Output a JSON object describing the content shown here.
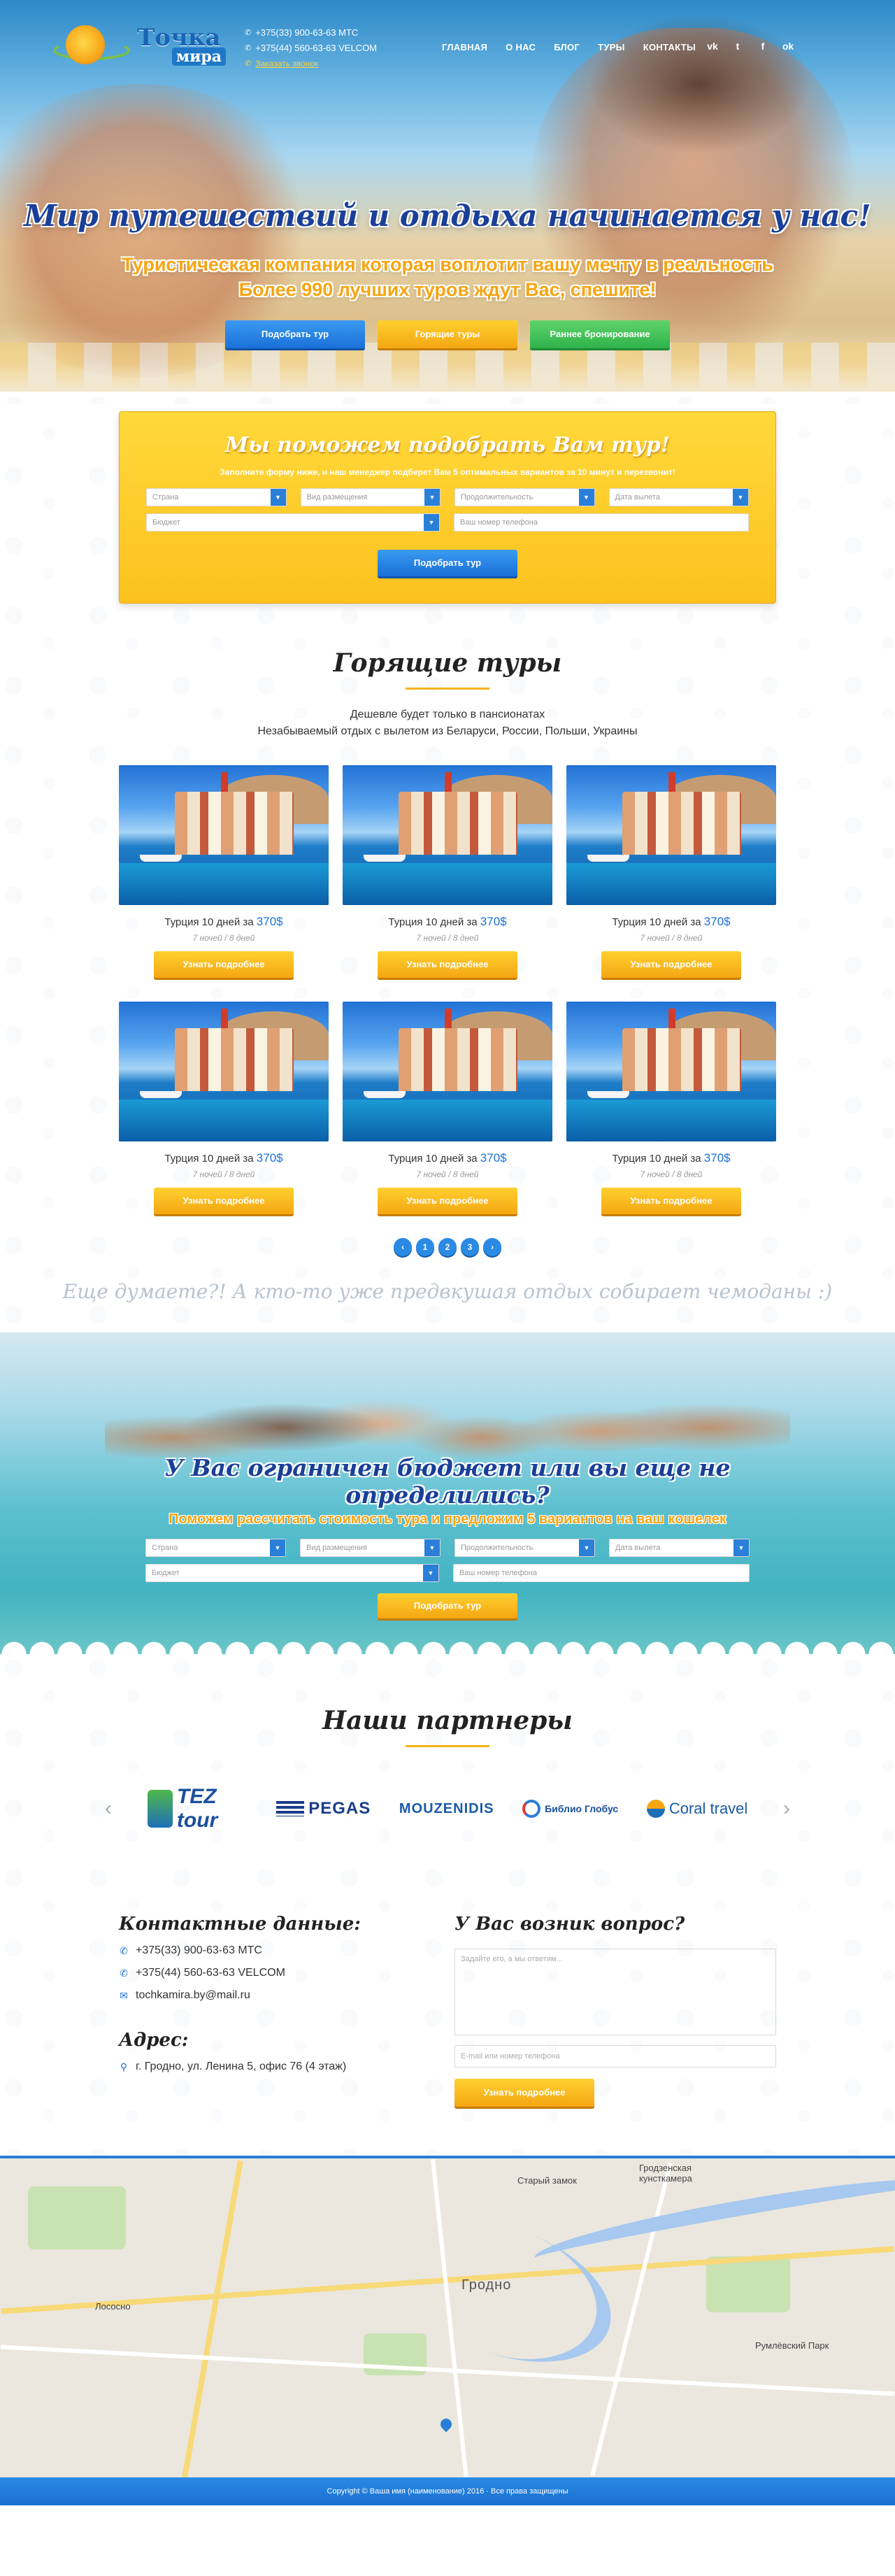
{
  "header": {
    "logo": {
      "line1": "Точка",
      "line2": "мира"
    },
    "phones": [
      {
        "icon": "phone-icon",
        "text": "+375(33) 900-63-63 МТС"
      },
      {
        "icon": "phone-icon",
        "text": "+375(44) 560-63-63 VELCOM"
      }
    ],
    "callback_label": "Заказать звонок",
    "nav": [
      "ГЛАВНАЯ",
      "О НАС",
      "БЛОГ",
      "ТУРЫ",
      "КОНТАКТЫ"
    ],
    "social": [
      {
        "icon": "vk-icon",
        "glyph": "vk"
      },
      {
        "icon": "twitter-icon",
        "glyph": "t"
      },
      {
        "icon": "facebook-icon",
        "glyph": "f"
      },
      {
        "icon": "odnoklassniki-icon",
        "glyph": "ok"
      }
    ]
  },
  "hero": {
    "title": "Мир путешествий и отдыха начинается у нас!",
    "subtitle_line1": "Туристическая компания которая воплотит вашу мечту в реальность",
    "subtitle_line2": "Более 990 лучших туров ждут Вас, спешите!",
    "buttons": [
      "Подобрать тур",
      "Горящие туры",
      "Раннее бронирование"
    ]
  },
  "tour_form": {
    "title": "Мы поможем подобрать Вам тур!",
    "description": "Заполните форму ниже, и наш менеджер подберет Вам 5 оптимальных вариантов за 10 минут и перезвонит!",
    "country_placeholder": "Страна",
    "accommodation_placeholder": "Вид размещения",
    "duration_placeholder": "Продолжительность",
    "date_placeholder": "Дата вылета",
    "budget_placeholder": "Бюджет",
    "phone_placeholder": "Ваш номер телефона",
    "submit_label": "Подобрать тур",
    "arrow_glyph": "▼"
  },
  "hot_tours": {
    "title": "Горящие туры",
    "desc_line1": "Дешевле будет только в пансионатах",
    "desc_line2": "Незабываемый отдых с вылетом из Беларуси, России, Польши, Украины",
    "cards": [
      {
        "name": "Турция 10 дней за ",
        "price": "370$",
        "nights": "7 ночей / 8 дней",
        "button": "Узнать подробнее"
      },
      {
        "name": "Турция 10 дней за ",
        "price": "370$",
        "nights": "7 ночей / 8 дней",
        "button": "Узнать подробнее"
      },
      {
        "name": "Турция 10 дней за ",
        "price": "370$",
        "nights": "7 ночей / 8 дней",
        "button": "Узнать подробнее"
      },
      {
        "name": "Турция 10 дней за ",
        "price": "370$",
        "nights": "7 ночей / 8 дней",
        "button": "Узнать подробнее"
      },
      {
        "name": "Турция 10 дней за ",
        "price": "370$",
        "nights": "7 ночей / 8 дней",
        "button": "Узнать подробнее"
      },
      {
        "name": "Турция 10 дней за ",
        "price": "370$",
        "nights": "7 ночей / 8 дней",
        "button": "Узнать подробнее"
      }
    ],
    "pagination": {
      "prev": "‹",
      "pages": [
        "1",
        "2",
        "3"
      ],
      "next": "›"
    },
    "quote": "Еще думаете?! А кто-то уже предвкушая отдых собирает чемоданы :)"
  },
  "budget": {
    "title": "У Вас ограничен бюджет или вы еще не определились?",
    "subtitle": "Поможем рассчитать стоимость тура и предложим 5 вариантов на ваш кошелек",
    "submit_label": "Подобрать тур"
  },
  "partners": {
    "title": "Наши партнеры",
    "prev": "‹",
    "next": "›",
    "logos": [
      "TEZ tour",
      "PEGAS",
      "MOUZENIDIS",
      "Библио Глобус",
      "Coral travel"
    ]
  },
  "contacts": {
    "title": "Контактные данные:",
    "lines": [
      {
        "icon": "phone-icon",
        "text": "+375(33) 900-63-63 МТС"
      },
      {
        "icon": "phone-icon",
        "text": "+375(44) 560-63-63 VELCOM"
      },
      {
        "icon": "mail-icon",
        "text": "tochkamira.by@mail.ru"
      }
    ],
    "address_title": "Адрес:",
    "address": "г. Гродно, ул. Ленина 5, офис 76 (4 этаж)"
  },
  "question": {
    "title": "У Вас возник вопрос?",
    "textarea_placeholder": "Задайте его, а мы ответим...",
    "contact_placeholder": "E-mail или номер телефона",
    "submit_label": "Узнать подробнее"
  },
  "map": {
    "labels": [
      "Гродно",
      "Лососно",
      "Гродзенская кунсткамера",
      "Старый замок",
      "Румлёвский Парк"
    ]
  },
  "footer": {
    "text": "Copyright © Ваша имя (наименование) 2016 · Все права защищены"
  },
  "colors": {
    "accent_blue": "#1a70d8",
    "accent_orange": "#f7a513",
    "accent_green": "#2fb24a"
  }
}
